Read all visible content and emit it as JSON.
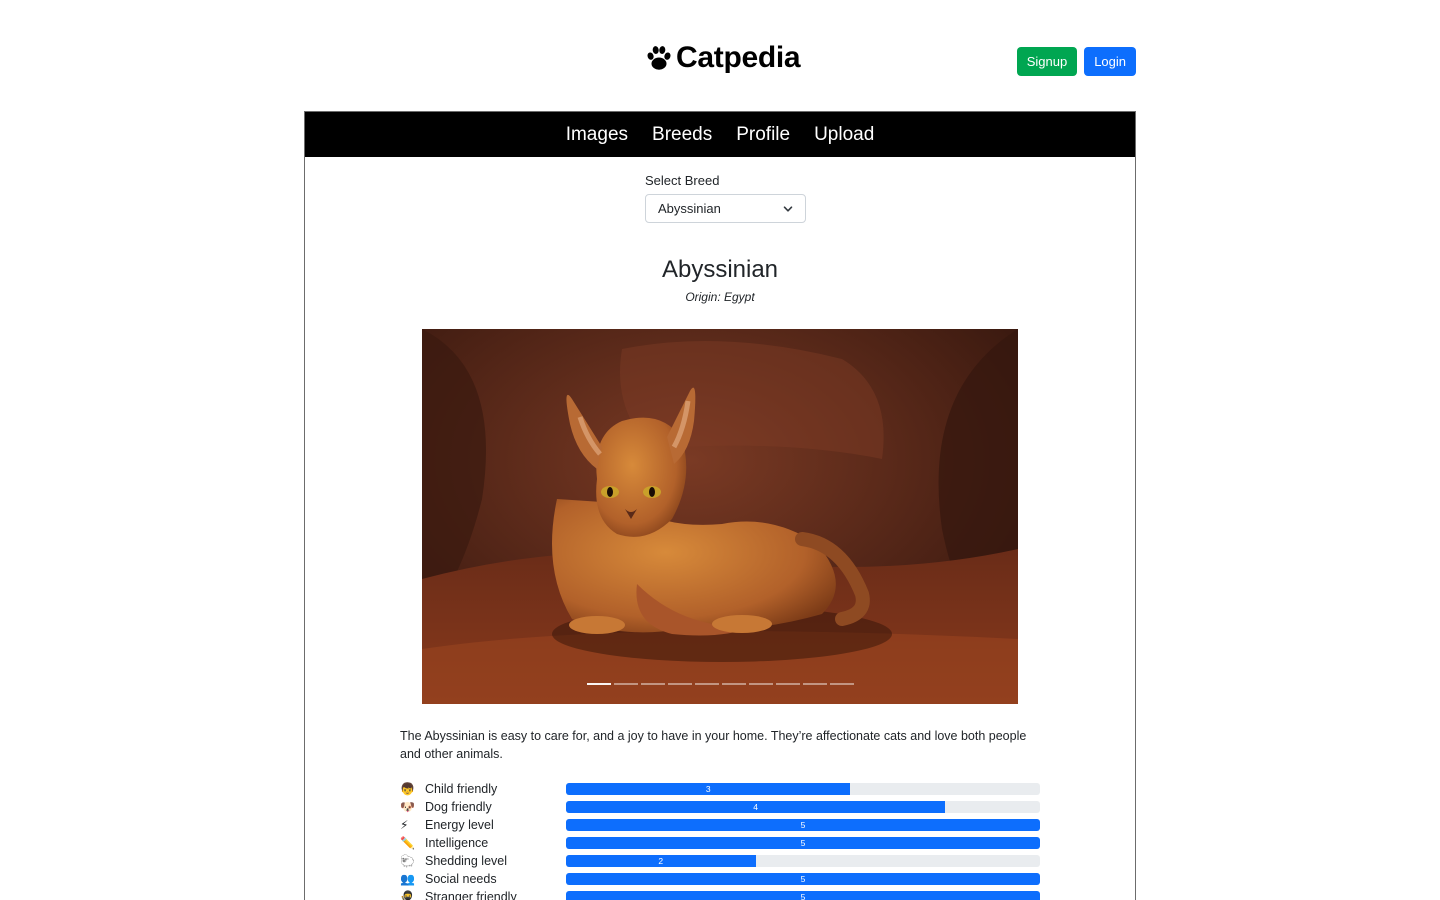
{
  "header": {
    "brand": "Catpedia",
    "signup_label": "Signup",
    "login_label": "Login"
  },
  "nav": {
    "items": [
      {
        "label": "Images"
      },
      {
        "label": "Breeds"
      },
      {
        "label": "Profile"
      },
      {
        "label": "Upload"
      }
    ]
  },
  "breed_select": {
    "label": "Select Breed",
    "selected": "Abyssinian"
  },
  "breed": {
    "name": "Abyssinian",
    "origin": "Origin: Egypt",
    "description": "The Abyssinian is easy to care for, and a joy to have in your home. They’re affectionate cats and love both people and other animals."
  },
  "carousel": {
    "slide_count": 10,
    "active_index": 0
  },
  "stats_max": 5,
  "stats": [
    {
      "icon": "child-icon",
      "glyph": "👦",
      "label": "Child friendly",
      "value": 3
    },
    {
      "icon": "dog-icon",
      "glyph": "🐶",
      "label": "Dog friendly",
      "value": 4
    },
    {
      "icon": "lightning-icon",
      "glyph": "⚡",
      "label": "Energy level",
      "value": 5
    },
    {
      "icon": "pencil-icon",
      "glyph": "✏️",
      "label": "Intelligence",
      "value": 5
    },
    {
      "icon": "sheep-icon",
      "glyph": "🐑",
      "label": "Shedding level",
      "value": 2
    },
    {
      "icon": "people-icon",
      "glyph": "👥",
      "label": "Social needs",
      "value": 5
    },
    {
      "icon": "stranger-icon",
      "glyph": "🥷",
      "label": "Stranger friendly",
      "value": 5
    }
  ],
  "colors": {
    "signup": "#00a651",
    "primary": "#0d6efd",
    "nav_background": "#000000",
    "bar_track": "#e9ecef"
  }
}
